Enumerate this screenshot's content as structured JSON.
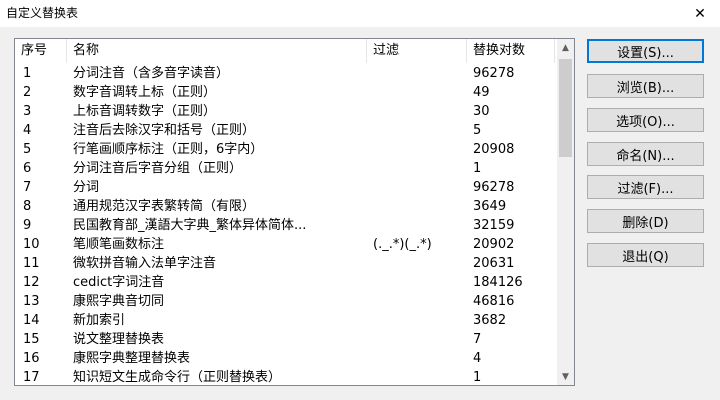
{
  "window": {
    "title": "自定义替换表",
    "close_glyph": "✕"
  },
  "table": {
    "columns": [
      "序号",
      "名称",
      "过滤",
      "替换对数"
    ],
    "rows": [
      {
        "no": "1",
        "name": "分词注音（含多音字读音）",
        "filter": "",
        "count": "96278"
      },
      {
        "no": "2",
        "name": "数字音调转上标（正则）",
        "filter": "",
        "count": "49"
      },
      {
        "no": "3",
        "name": "上标音调转数字（正则）",
        "filter": "",
        "count": "30"
      },
      {
        "no": "4",
        "name": "注音后去除汉字和括号（正则）",
        "filter": "",
        "count": "5"
      },
      {
        "no": "5",
        "name": "行笔画顺序标注（正则，6字内）",
        "filter": "",
        "count": "20908"
      },
      {
        "no": "6",
        "name": "分词注音后字音分组（正则）",
        "filter": "",
        "count": "1"
      },
      {
        "no": "7",
        "name": "分词",
        "filter": "",
        "count": "96278"
      },
      {
        "no": "8",
        "name": "通用规范汉字表繁转简（有限）",
        "filter": "",
        "count": "3649"
      },
      {
        "no": "9",
        "name": "民国教育部_漢語大字典_繁体异体简体...",
        "filter": "",
        "count": "32159"
      },
      {
        "no": "10",
        "name": "笔顺笔画数标注",
        "filter": "(._.*)(_.*)",
        "count": "20902"
      },
      {
        "no": "11",
        "name": "微软拼音输入法单字注音",
        "filter": "",
        "count": "20631"
      },
      {
        "no": "12",
        "name": "cedict字词注音",
        "filter": "",
        "count": "184126"
      },
      {
        "no": "13",
        "name": "康熙字典音切同",
        "filter": "",
        "count": "46816"
      },
      {
        "no": "14",
        "name": "新加索引",
        "filter": "",
        "count": "3682"
      },
      {
        "no": "15",
        "name": "说文整理替换表",
        "filter": "",
        "count": "7"
      },
      {
        "no": "16",
        "name": "康熙字典整理替换表",
        "filter": "",
        "count": "4"
      },
      {
        "no": "17",
        "name": "知识短文生成命令行（正则替换表）",
        "filter": "",
        "count": "1"
      }
    ]
  },
  "scrollbar": {
    "up_glyph": "▲",
    "down_glyph": "▼"
  },
  "buttons": {
    "settings": "设置(S)...",
    "browse": "浏览(B)...",
    "options": "选项(O)...",
    "rename": "命名(N)...",
    "filter": "过滤(F)...",
    "delete": "删除(D)",
    "exit": "退出(Q)"
  }
}
